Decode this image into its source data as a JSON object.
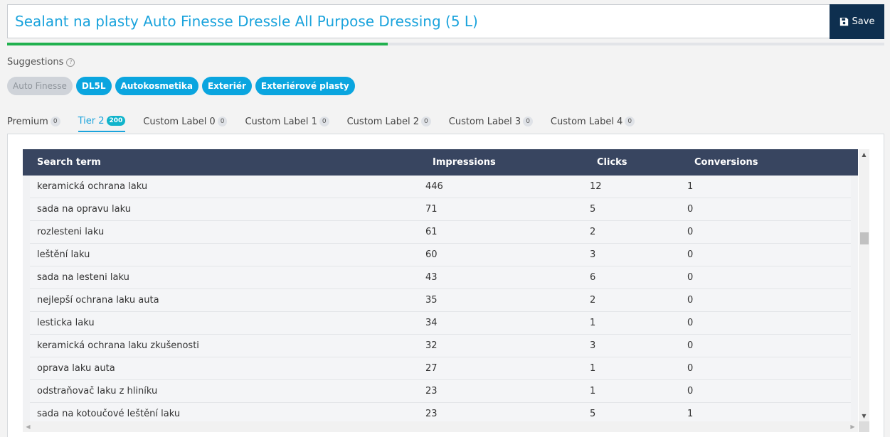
{
  "title": {
    "value": "Sealant na plasty Auto Finesse Dressle All Purpose Dressing (5 L)",
    "save_label": "Save"
  },
  "progress": {
    "percent": 43.4,
    "color": "#21b14f"
  },
  "suggestions": {
    "label": "Suggestions",
    "help_icon": "?",
    "chips": [
      {
        "label": "Auto Finesse",
        "disabled": true
      },
      {
        "label": "DL5L",
        "disabled": false
      },
      {
        "label": "Autokosmetika",
        "disabled": false
      },
      {
        "label": "Exteriér",
        "disabled": false
      },
      {
        "label": "Exteriérové plasty",
        "disabled": false
      }
    ]
  },
  "tabs": [
    {
      "label": "Premium",
      "count": "0",
      "active": false
    },
    {
      "label": "Tier 2",
      "count": "200",
      "active": true
    },
    {
      "label": "Custom Label 0",
      "count": "0",
      "active": false
    },
    {
      "label": "Custom Label 1",
      "count": "0",
      "active": false
    },
    {
      "label": "Custom Label 2",
      "count": "0",
      "active": false
    },
    {
      "label": "Custom Label 3",
      "count": "0",
      "active": false
    },
    {
      "label": "Custom Label 4",
      "count": "0",
      "active": false
    }
  ],
  "table": {
    "headers": [
      "Search term",
      "Impressions",
      "Clicks",
      "Conversions"
    ],
    "rows": [
      [
        "keramická ochrana laku",
        "446",
        "12",
        "1"
      ],
      [
        "sada na opravu laku",
        "71",
        "5",
        "0"
      ],
      [
        "rozlesteni laku",
        "61",
        "2",
        "0"
      ],
      [
        "leštění laku",
        "60",
        "3",
        "0"
      ],
      [
        "sada na lesteni laku",
        "43",
        "6",
        "0"
      ],
      [
        "nejlepší ochrana laku auta",
        "35",
        "2",
        "0"
      ],
      [
        "lesticka laku",
        "34",
        "1",
        "0"
      ],
      [
        "keramická ochrana laku zkušenosti",
        "32",
        "3",
        "0"
      ],
      [
        "oprava laku auta",
        "27",
        "1",
        "0"
      ],
      [
        "odstraňovač laku z hliníku",
        "23",
        "1",
        "0"
      ],
      [
        "sada na kotoučové leštění laku",
        "23",
        "5",
        "1"
      ]
    ]
  },
  "colors": {
    "accent": "#1aa3dc",
    "save_bg": "#0e2f4f",
    "table_header": "#384560",
    "chip": "#0aa5df"
  }
}
